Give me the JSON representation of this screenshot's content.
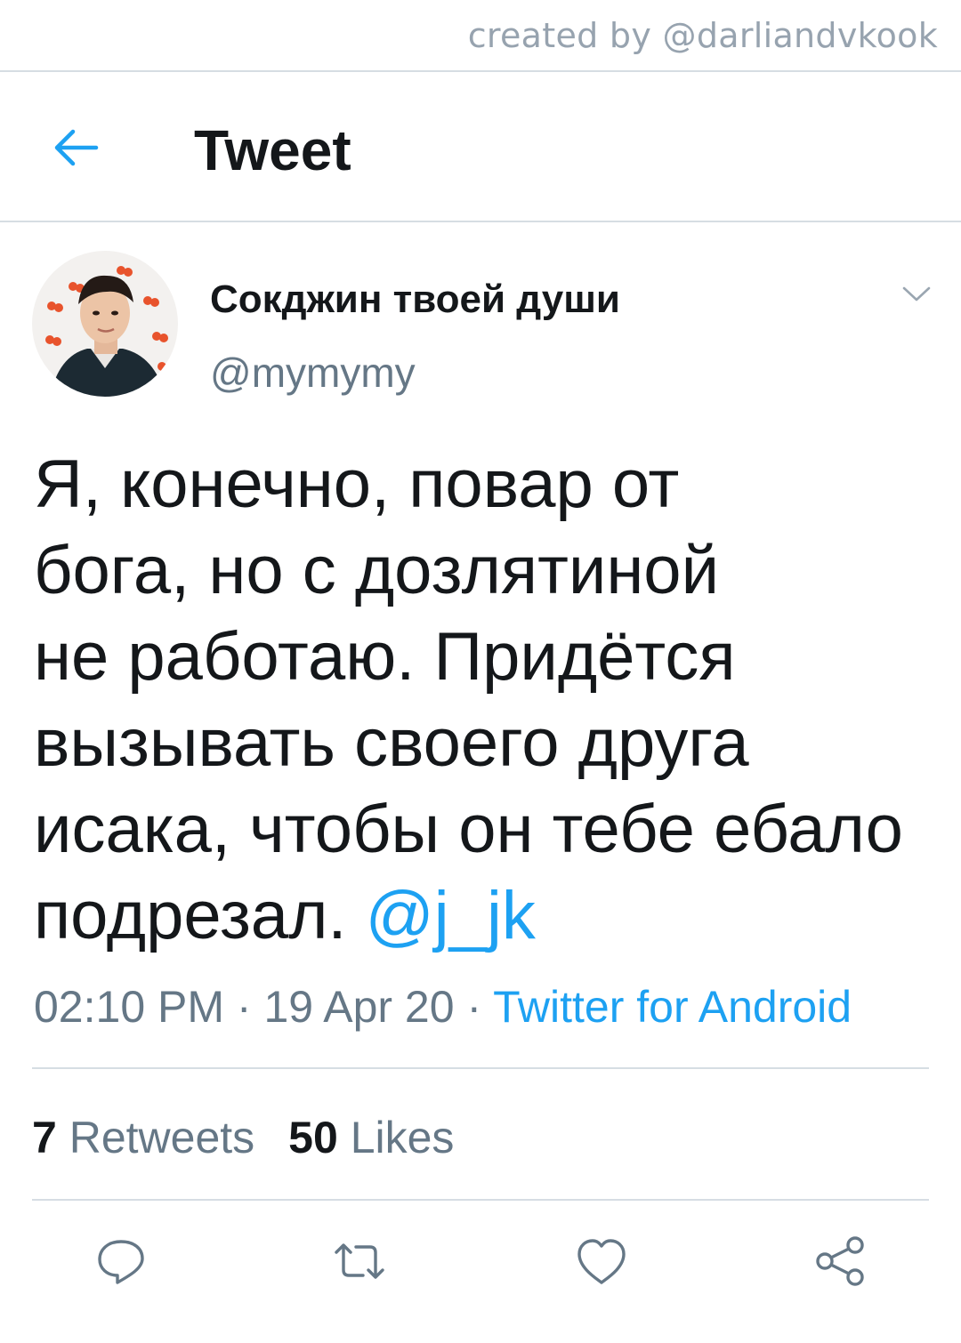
{
  "watermark": "created by @darliandvkook",
  "header": {
    "title": "Tweet",
    "back_icon": "arrow-left-icon"
  },
  "author": {
    "display_name": "Сокджин твоей души",
    "handle": "@mymymy",
    "avatar_icon": "profile-photo"
  },
  "tweet": {
    "text": "Я, конечно, повар от\nбога, но с дозлятиной\nне работаю. Придётся\nвызывать своего друга\nисака, чтобы он тебе ебало\nподрезал. ",
    "mention": "@j_jk",
    "time": "02:10 PM",
    "separator": "·",
    "date": "19 Apr 20",
    "source": "Twitter for Android"
  },
  "stats": {
    "retweets_count": "7",
    "retweets_label": "Retweets",
    "likes_count": "50",
    "likes_label": "Likes"
  },
  "actions": {
    "icons": [
      "reply-icon",
      "retweet-icon",
      "like-icon",
      "share-icon"
    ]
  },
  "colors": {
    "accent": "#1da1f2",
    "text_primary": "#14171a",
    "text_secondary": "#657786",
    "divider": "#d6dde3",
    "watermark": "#97a3af"
  }
}
